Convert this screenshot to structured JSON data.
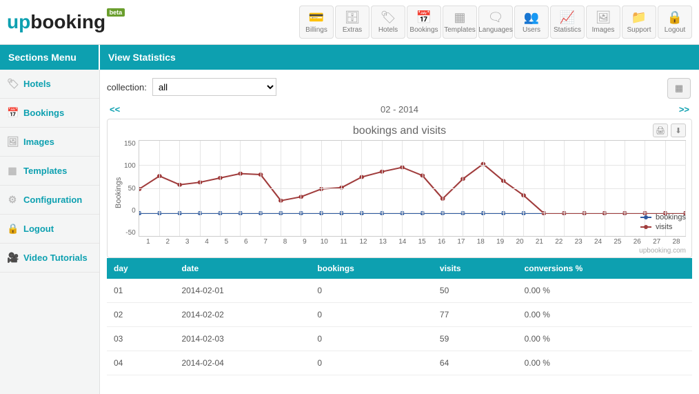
{
  "logo": {
    "part1": "up",
    "part2": "booking",
    "badge": "beta"
  },
  "topnav": [
    {
      "label": "Billings",
      "icon": "💳"
    },
    {
      "label": "Extras",
      "icon": "🗄"
    },
    {
      "label": "Hotels",
      "icon": "🏷"
    },
    {
      "label": "Bookings",
      "icon": "📅"
    },
    {
      "label": "Templates",
      "icon": "▦"
    },
    {
      "label": "Languages",
      "icon": "🗨"
    },
    {
      "label": "Users",
      "icon": "👥"
    },
    {
      "label": "Statistics",
      "icon": "📈"
    },
    {
      "label": "Images",
      "icon": "🖼"
    },
    {
      "label": "Support",
      "icon": "📁"
    },
    {
      "label": "Logout",
      "icon": "🔒"
    }
  ],
  "bar": {
    "left": "Sections Menu",
    "right": "View Statistics"
  },
  "sidebar": [
    {
      "label": "Hotels",
      "icon": "🏷"
    },
    {
      "label": "Bookings",
      "icon": "📅"
    },
    {
      "label": "Images",
      "icon": "🖼"
    },
    {
      "label": "Templates",
      "icon": "▦"
    },
    {
      "label": "Configuration",
      "icon": "⚙"
    },
    {
      "label": "Logout",
      "icon": "🔒"
    },
    {
      "label": "Video Tutorials",
      "icon": "🎥"
    }
  ],
  "collection": {
    "label": "collection:",
    "value": "all"
  },
  "nav": {
    "prev": "<<",
    "period": "02 - 2014",
    "next": ">>"
  },
  "chart_data": {
    "type": "line",
    "title": "bookings and visits",
    "xlabel": "",
    "ylabel": "Bookings",
    "ylim": [
      -50,
      150
    ],
    "yticks": [
      -50,
      0,
      50,
      100,
      150
    ],
    "categories": [
      "1",
      "2",
      "3",
      "4",
      "5",
      "6",
      "7",
      "8",
      "9",
      "10",
      "11",
      "12",
      "13",
      "14",
      "15",
      "16",
      "17",
      "18",
      "19",
      "20",
      "21",
      "22",
      "23",
      "24",
      "25",
      "26",
      "27",
      "28"
    ],
    "series": [
      {
        "name": "bookings",
        "color": "#2d5aa0",
        "values": [
          0,
          0,
          0,
          0,
          0,
          0,
          0,
          0,
          0,
          0,
          0,
          0,
          0,
          0,
          0,
          0,
          0,
          0,
          0,
          0,
          0,
          0,
          0,
          0,
          0,
          0,
          0,
          0
        ]
      },
      {
        "name": "visits",
        "color": "#a03c3c",
        "values": [
          50,
          77,
          59,
          64,
          73,
          82,
          80,
          26,
          34,
          50,
          53,
          75,
          86,
          95,
          78,
          30,
          71,
          102,
          67,
          37,
          0,
          0,
          0,
          0,
          0,
          0,
          0,
          0
        ]
      }
    ],
    "credit": "upbooking.com"
  },
  "table": {
    "headers": [
      "day",
      "date",
      "bookings",
      "visits",
      "conversions %"
    ],
    "rows": [
      [
        "01",
        "2014-02-01",
        "0",
        "50",
        "0.00 %"
      ],
      [
        "02",
        "2014-02-02",
        "0",
        "77",
        "0.00 %"
      ],
      [
        "03",
        "2014-02-03",
        "0",
        "59",
        "0.00 %"
      ],
      [
        "04",
        "2014-02-04",
        "0",
        "64",
        "0.00 %"
      ]
    ]
  }
}
